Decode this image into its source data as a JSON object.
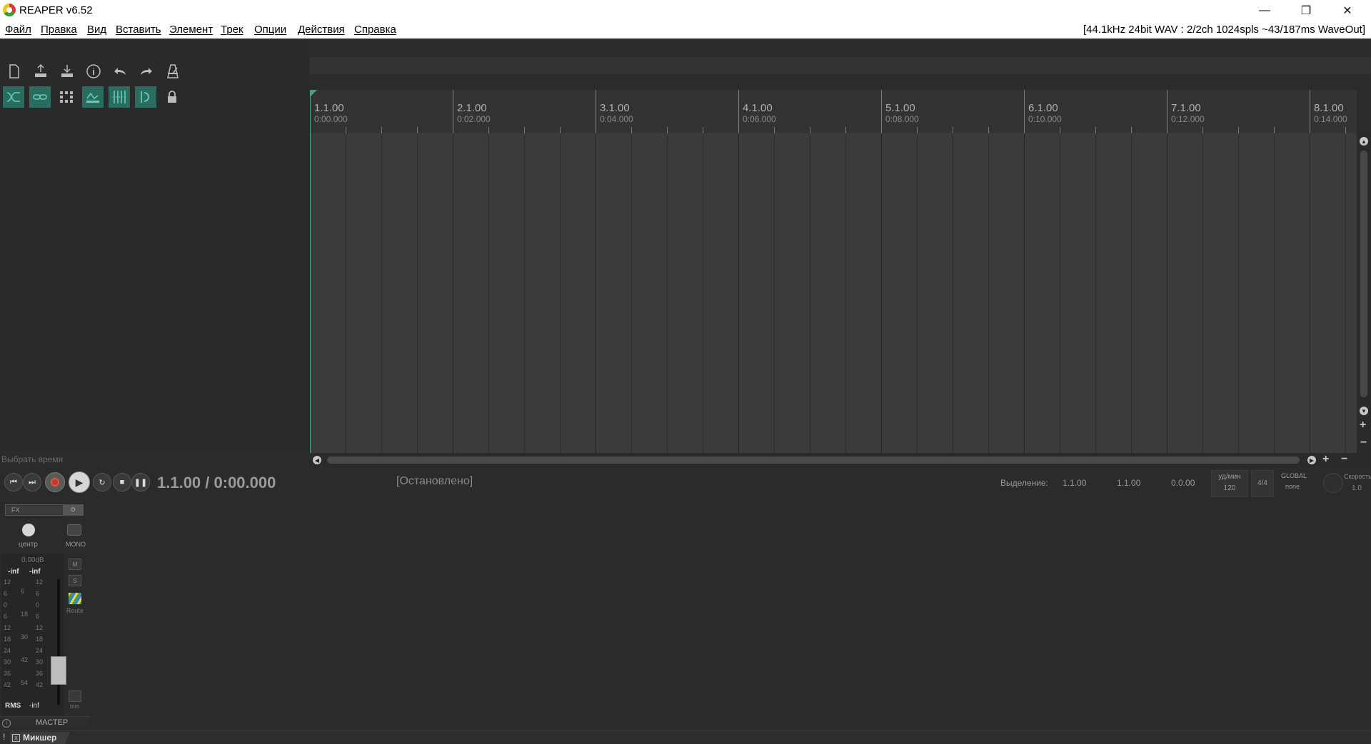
{
  "window": {
    "title": "REAPER v6.52",
    "minimize": "—",
    "restore": "❐",
    "close": "✕"
  },
  "menu": {
    "items": [
      "Файл",
      "Правка",
      "Вид",
      "Вставить",
      "Элемент",
      "Трек",
      "Опции",
      "Действия",
      "Справка"
    ],
    "audio_status": "[44.1kHz 24bit WAV : 2/2ch 1024spls ~43/187ms WaveOut]"
  },
  "toolbar": {
    "row1": [
      "new-project-icon",
      "save-icon",
      "open-icon",
      "info-icon",
      "undo-icon",
      "redo-icon",
      "metronome-icon"
    ],
    "row2": [
      "auto-crossfade-icon",
      "grouping-icon",
      "grid-snap-icon",
      "envelope-lock-icon",
      "snap-grid-icon",
      "ripple-icon",
      "lock-icon"
    ],
    "accent_color": "#2c6b5f"
  },
  "ruler": {
    "marks": [
      {
        "bar": "1.1.00",
        "time": "0:00.000"
      },
      {
        "bar": "2.1.00",
        "time": "0:02.000"
      },
      {
        "bar": "3.1.00",
        "time": "0:04.000"
      },
      {
        "bar": "4.1.00",
        "time": "0:06.000"
      },
      {
        "bar": "5.1.00",
        "time": "0:08.000"
      },
      {
        "bar": "6.1.00",
        "time": "0:10.000"
      },
      {
        "bar": "7.1.00",
        "time": "0:12.000"
      },
      {
        "bar": "8.1.00",
        "time": "0:14.000"
      }
    ]
  },
  "transport": {
    "select_time_label": "Выбрать время",
    "time_display": "1.1.00 / 0:00.000",
    "status": "[Остановлено]",
    "selection_label": "Выделение:",
    "selection_start": "1.1.00",
    "selection_end": "1.1.00",
    "selection_length": "0.0.00",
    "tempo_label": "уд/мин",
    "tempo_value": "120",
    "time_signature": "4/4",
    "global_label": "GLOBAL",
    "global_mode": "none",
    "rate_label": "Скорость",
    "rate_value": "1.0",
    "record_color": "#c0392b"
  },
  "master": {
    "fx_label": "FX",
    "pan_label": "центр",
    "mono_label": "MONO",
    "volume": "0.00dB",
    "peak_left": "-inf",
    "peak_right": "-inf",
    "mute": "M",
    "solo": "S",
    "route_label": "Route",
    "trim_label": "trim",
    "rms_label": "RMS",
    "rms_value": "-inf",
    "name": "МАСТЕР",
    "scale_left": [
      "12",
      "6",
      "0",
      "6",
      "12",
      "18",
      "24",
      "30",
      "36",
      "42"
    ],
    "scale_center": [
      "6",
      "18",
      "30",
      "42",
      "54"
    ],
    "scale_right": [
      "12",
      "6",
      "0",
      "6",
      "12",
      "18",
      "24",
      "30",
      "36",
      "42"
    ]
  },
  "docker": {
    "tab_label": "Микшер",
    "pin": "!",
    "close": "x"
  }
}
